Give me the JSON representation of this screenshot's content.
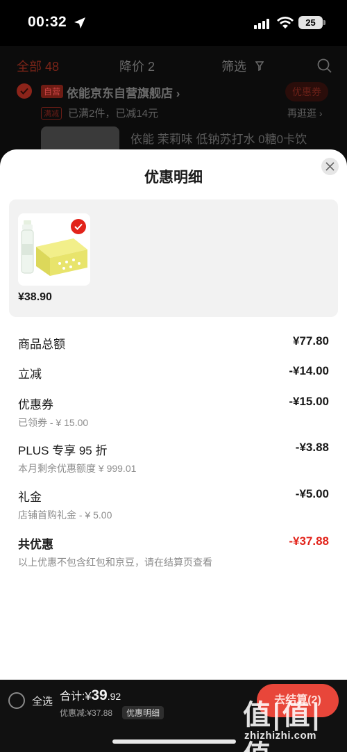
{
  "status_bar": {
    "time": "00:32",
    "battery": "25"
  },
  "cart": {
    "tabs": [
      {
        "label": "全部 48"
      },
      {
        "label": "降价 2"
      },
      {
        "label": "筛选"
      }
    ],
    "shop": {
      "self_tag": "自营",
      "name": "依能京东自营旗舰店 ›",
      "coupon_label": "优惠券"
    },
    "promo": {
      "tag": "满减",
      "text": "已满2件，已减14元",
      "more": "再逛逛 ›"
    },
    "product_title": "依能 茉莉味 低钠苏打水 0糖0卡饮"
  },
  "sheet": {
    "title": "优惠明细",
    "product": {
      "price": "¥38.90"
    },
    "rows": [
      {
        "label": "商品总额",
        "value": "¥77.80",
        "sub": ""
      },
      {
        "label": "立减",
        "value": "-¥14.00",
        "sub": ""
      },
      {
        "label": "优惠券",
        "value": "-¥15.00",
        "sub": "已领券 - ¥ 15.00"
      },
      {
        "label": "PLUS 专享 95 折",
        "value": "-¥3.88",
        "sub": "本月剩余优惠额度 ¥ 999.01"
      },
      {
        "label": "礼金",
        "value": "-¥5.00",
        "sub": "店铺首购礼金 - ¥ 5.00"
      }
    ],
    "total": {
      "label": "共优惠",
      "value": "-¥37.88",
      "note": "以上优惠不包含红包和京豆，请在结算页查看"
    }
  },
  "bottom_bar": {
    "select_all": "全选",
    "total_prefix": "合计:¥",
    "total_int": "39",
    "total_dec": ".92",
    "discount": "优惠减:¥37.88",
    "detail_chip": "优惠明细",
    "checkout": "去结算(2)"
  },
  "watermark": {
    "glyphs": "值|值|值",
    "text": "zhizhizhi.com"
  },
  "colors": {
    "accent": "#e2231a",
    "checkout": "#e8463a"
  }
}
